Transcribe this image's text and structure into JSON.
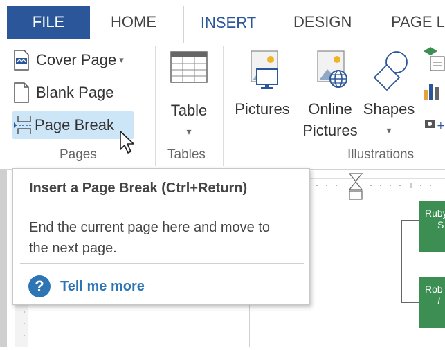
{
  "tabs": {
    "file": "FILE",
    "home": "HOME",
    "insert": "INSERT",
    "design": "DESIGN",
    "page_layout": "PAGE LA"
  },
  "ribbon": {
    "pages": {
      "cover_page": "Cover Page",
      "blank_page": "Blank Page",
      "page_break": "Page Break",
      "group_label": "Pages"
    },
    "tables": {
      "table": "Table",
      "group_label": "Tables"
    },
    "illustrations": {
      "pictures": "Pictures",
      "online_pictures_line1": "Online",
      "online_pictures_line2": "Pictures",
      "shapes": "Shapes",
      "group_label": "Illustrations"
    }
  },
  "tooltip": {
    "title": "Insert a Page Break (Ctrl+Return)",
    "description": "End the current page here and move to the next page.",
    "help_link": "Tell me more"
  },
  "document": {
    "org_box_1_line1": "Ruby",
    "org_box_1_line2": "S",
    "org_box_2_line1": "Rob",
    "org_box_2_line2": "I"
  },
  "colors": {
    "accent": "#2b579a",
    "highlight": "#cde6f7",
    "help_blue": "#2e75b6",
    "org_green": "#3c8e52"
  }
}
